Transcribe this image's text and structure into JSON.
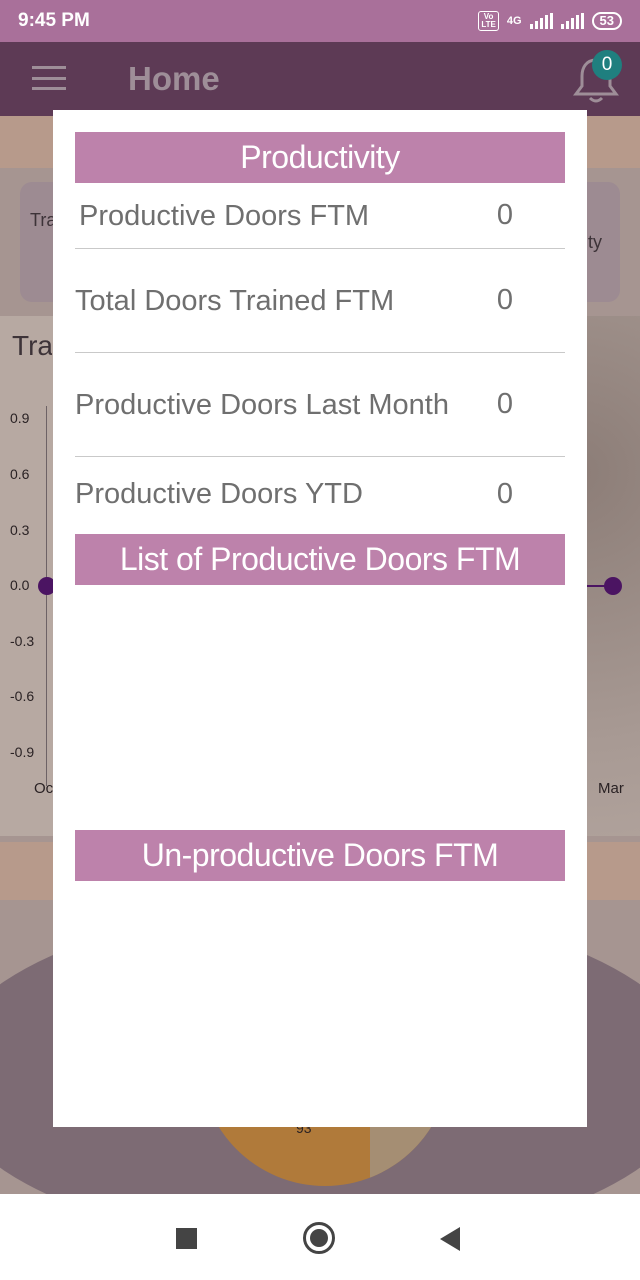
{
  "status_bar": {
    "time": "9:45 PM",
    "volte_label": "Vo\nLTE",
    "network": "4G",
    "battery": "53"
  },
  "app_bar": {
    "title": "Home",
    "notification_count": "0"
  },
  "background": {
    "card_text_left": "Tra Co FT",
    "card_text_right": "ity",
    "section_title": "Tra",
    "y_ticks": [
      "0.9",
      "0.6",
      "0.3",
      "0.0",
      "-0.3",
      "-0.6",
      "-0.9"
    ],
    "x_tick_first": "Oc",
    "x_tick_last": "Mar",
    "pie_label": "93"
  },
  "modal": {
    "productivity_header": "Productivity",
    "rows": [
      {
        "label": "Productive Doors FTM",
        "value": "0"
      },
      {
        "label": "Total Doors Trained FTM",
        "value": "0"
      },
      {
        "label": "Productive Doors Last Month",
        "value": "0"
      },
      {
        "label": "Productive Doors YTD",
        "value": "0"
      }
    ],
    "list_productive_header": "List of Productive Doors FTM",
    "unproductive_header": "Un-productive Doors FTM"
  }
}
